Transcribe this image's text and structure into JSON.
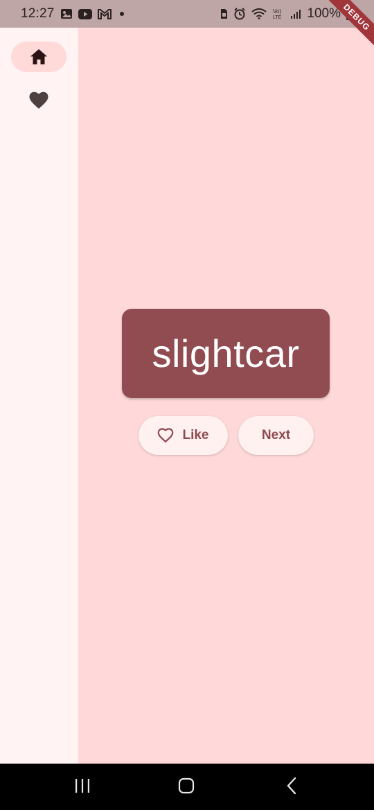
{
  "status_bar": {
    "time": "12:27",
    "battery": "100%",
    "left_icons": [
      "gallery-icon",
      "youtube-icon",
      "gmail-icon",
      "notification-dot"
    ],
    "right_icons": [
      "sim-icon",
      "alarm-icon",
      "wifi-icon",
      "volte-icon",
      "signal-icon",
      "battery-icon"
    ]
  },
  "debug_banner": {
    "label": "DEBUG"
  },
  "nav_rail": {
    "destinations": [
      {
        "icon": "home-icon",
        "selected": true
      },
      {
        "icon": "heart-icon",
        "selected": false
      }
    ]
  },
  "main": {
    "word": "slightcar",
    "like_button": {
      "label": "Like",
      "icon": "heart-outline-icon"
    },
    "next_button": {
      "label": "Next"
    }
  },
  "system_nav": {
    "buttons": [
      "recent-apps",
      "home",
      "back"
    ]
  },
  "colors": {
    "status_bar_bg": "#bfa6a6",
    "rail_bg": "#fff4f3",
    "main_bg": "#ffd9d9",
    "card_bg": "#914c51",
    "button_bg": "#fff1f0",
    "button_text": "#8d4a4f",
    "selected_pill": "#ffdad9",
    "debug_ribbon": "#a0353a"
  }
}
